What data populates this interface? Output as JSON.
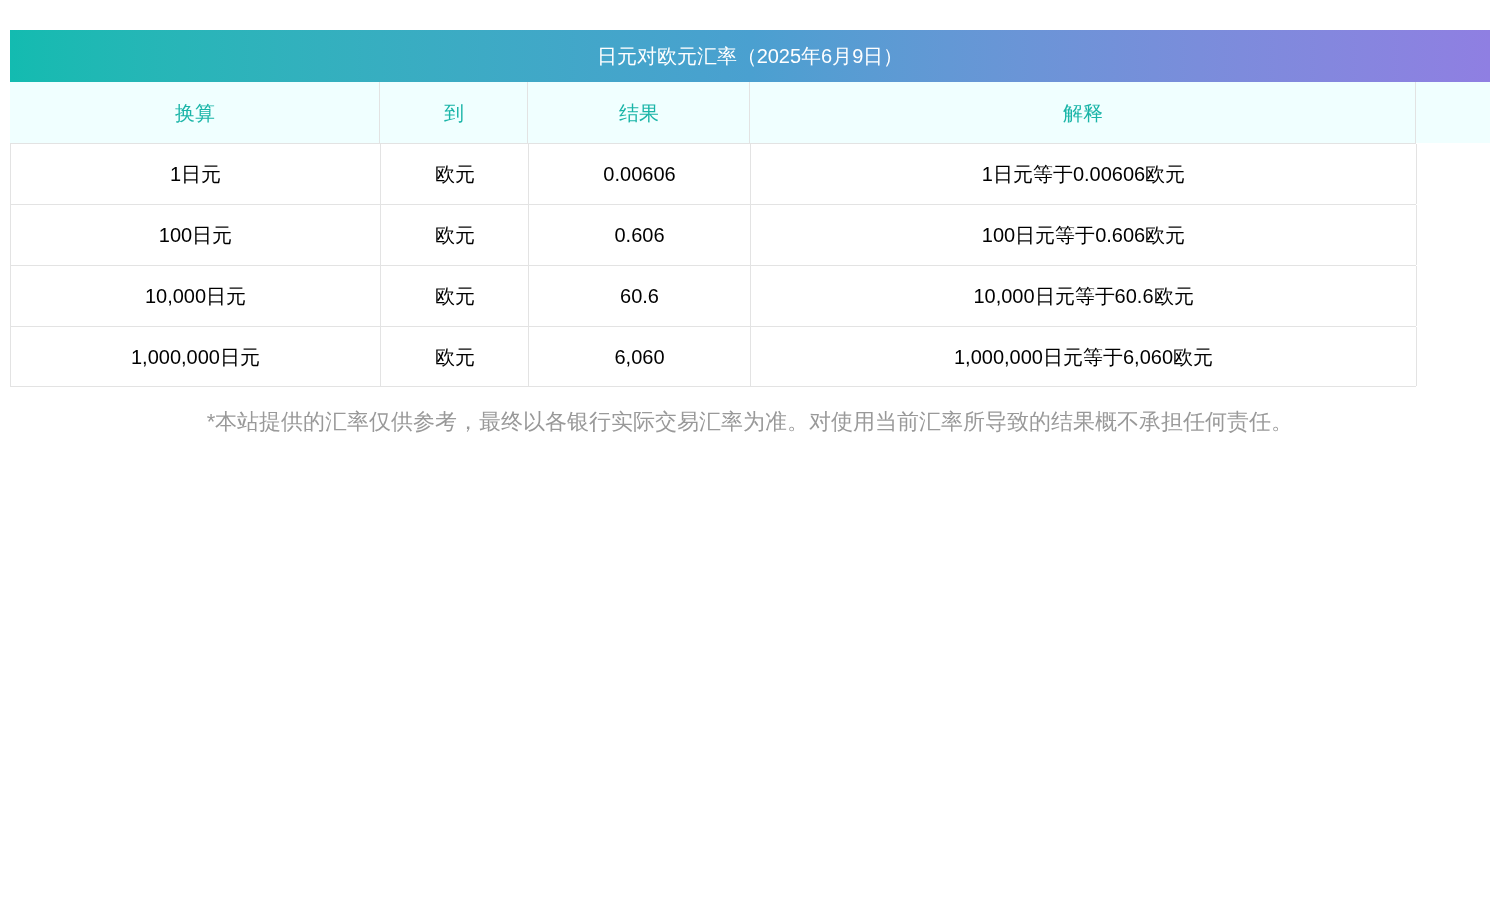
{
  "title": "日元对欧元汇率（2025年6月9日）",
  "columns": [
    "换算",
    "到",
    "结果",
    "解释"
  ],
  "rows": [
    [
      "1日元",
      "欧元",
      "0.00606",
      "1日元等于0.00606欧元"
    ],
    [
      "100日元",
      "欧元",
      "0.606",
      "100日元等于0.606欧元"
    ],
    [
      "10,000日元",
      "欧元",
      "60.6",
      "10,000日元等于60.6欧元"
    ],
    [
      "1,000,000日元",
      "欧元",
      "6,060",
      "1,000,000日元等于6,060欧元"
    ]
  ],
  "note": "*本站提供的汇率仅供参考，最终以各银行实际交易汇率为准。对使用当前汇率所导致的结果概不承担任何责任。"
}
